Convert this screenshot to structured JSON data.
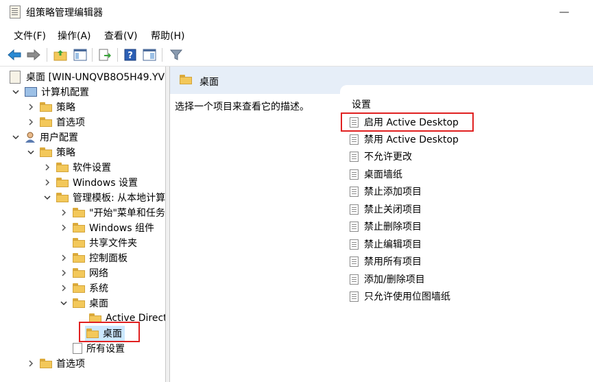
{
  "window": {
    "title": "组策略管理编辑器",
    "minimize_glyph": "—"
  },
  "menu": [
    "文件(F)",
    "操作(A)",
    "查看(V)",
    "帮助(H)"
  ],
  "toolbar": {
    "icons": [
      "back-arrow-icon",
      "forward-arrow-icon",
      "up-folder-icon",
      "show-hide-tree-icon",
      "export-list-icon",
      "help-icon",
      "properties-icon",
      "filter-icon"
    ]
  },
  "tree": {
    "root": "桌面 [WIN-UNQVB8O5H49.YV",
    "computer_config": "计算机配置",
    "cc_policy": "策略",
    "cc_preferences": "首选项",
    "user_config": "用户配置",
    "uc_policy": "策略",
    "software_settings": "软件设置",
    "windows_settings": "Windows 设置",
    "admin_templates": "管理模板: 从本地计算",
    "start_menu": "\"开始\"菜单和任务",
    "windows_components": "Windows 组件",
    "shared_folders": "共享文件夹",
    "control_panel": "控制面板",
    "network": "网络",
    "system": "系统",
    "desktop": "桌面",
    "active_directory": "Active Direct",
    "desktop_sub": "桌面",
    "all_settings": "所有设置",
    "uc_preferences": "首选项"
  },
  "right": {
    "header": "桌面",
    "description": "选择一个项目来查看它的描述。",
    "settings_header": "设置",
    "settings": [
      "启用 Active Desktop",
      "禁用 Active Desktop",
      "不允许更改",
      "桌面墙纸",
      "禁止添加项目",
      "禁止关闭项目",
      "禁止删除项目",
      "禁止编辑项目",
      "禁用所有项目",
      "添加/删除项目",
      "只允许使用位图墙纸"
    ]
  },
  "colors": {
    "highlight_box": "#e02020",
    "header_bg": "#e6eef8",
    "folder": "#f3c85a"
  }
}
